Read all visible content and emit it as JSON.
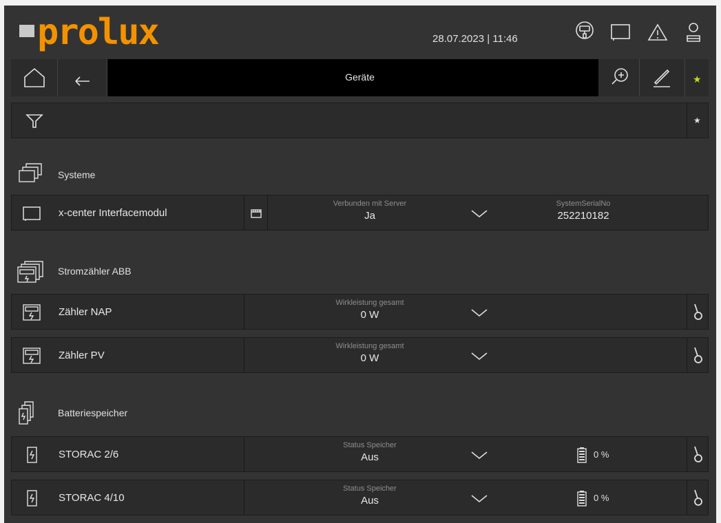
{
  "header": {
    "logo_text": "prolux",
    "datetime": "28.07.2023 | 11:46",
    "icons": [
      "paint-roller-icon",
      "monitor-icon",
      "warning-icon",
      "user-icon"
    ]
  },
  "toolbar": {
    "title": "Geräte",
    "star_color": "#c8d820"
  },
  "sections": {
    "systeme": "Systeme",
    "stromzaehler": "Stromzähler ABB",
    "batterie": "Batteriespeicher"
  },
  "rows": {
    "xcenter": {
      "name": "x-center Interfacemodul",
      "field1_caption": "Verbunden mit Server",
      "field1_value": "Ja",
      "field2_caption": "SystemSerialNo",
      "field2_value": "252210182"
    },
    "nap": {
      "name": "Zähler NAP",
      "field1_caption": "Wirkleistung gesamt",
      "field1_value": "0 W"
    },
    "pv": {
      "name": "Zähler PV",
      "field1_caption": "Wirkleistung gesamt",
      "field1_value": "0 W"
    },
    "storac26": {
      "name": "STORAC 2/6",
      "field1_caption": "Status Speicher",
      "field1_value": "Aus",
      "battery_value": "0 %"
    },
    "storac410": {
      "name": "STORAC 4/10",
      "field1_caption": "Status Speicher",
      "field1_value": "Aus",
      "battery_value": "0 %"
    }
  },
  "colors": {
    "brand_orange": "#f39200",
    "logo_gray": "#c9c9c9",
    "background": "#333333"
  }
}
